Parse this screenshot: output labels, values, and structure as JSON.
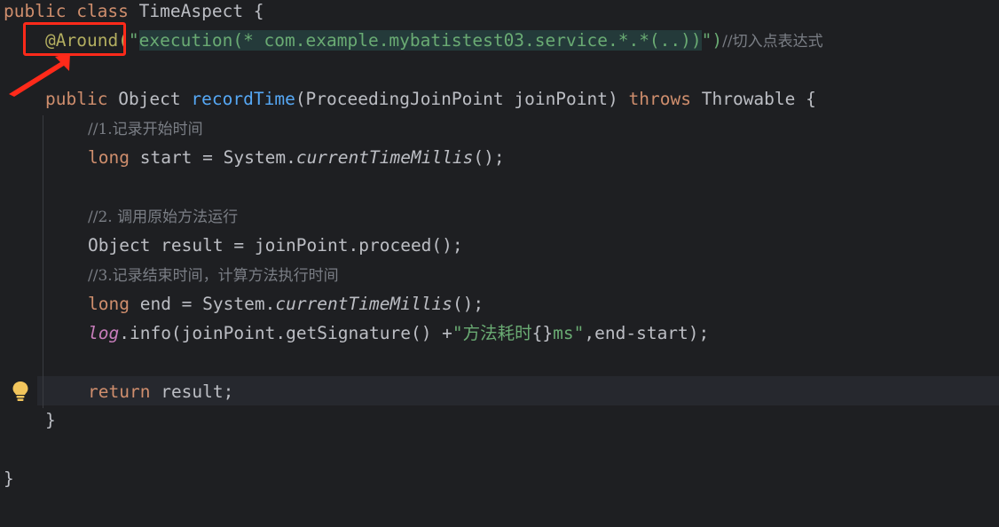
{
  "code": {
    "l1_public": "public",
    "l1_class": "class",
    "l1_name": "TimeAspect {",
    "l2_anno": "@Around(",
    "l2_quote_open": "\"",
    "l2_expr": "execution(* com.example.mybatistest03.service.*.*(..))",
    "l2_quote_close": "\")",
    "l2_comment": "//切入点表达式",
    "l3_public": "public",
    "l3_type": "Object",
    "l3_method": "recordTime",
    "l3_params": "(ProceedingJoinPoint joinPoint)",
    "l3_throws": "throws",
    "l3_rest": "Throwable {",
    "l4_comment": "//1.记录开始时间",
    "l5_long": "long",
    "l5_var": "start = System.",
    "l5_call": "currentTimeMillis",
    "l5_end": "();",
    "l6_comment": "//2. 调用原始方法运行",
    "l7_code": "Object result = joinPoint.proceed();",
    "l8_comment": "//3.记录结束时间，计算方法执行时间",
    "l9_long": "long",
    "l9_var": "end = System.",
    "l9_call": "currentTimeMillis",
    "l9_end": "();",
    "l10_log": "log",
    "l10_mid": ".info(joinPoint.getSignature() +",
    "l10_str1": "\"方法耗时",
    "l10_braces": "{}",
    "l10_str2": "ms\"",
    "l10_end": ",end-start);",
    "l11_return": "return",
    "l11_rest": "result;",
    "l12_close": "}",
    "l13_close": "}"
  },
  "icons": {
    "bulb": "lightbulb-icon",
    "arrow": "red-arrow-annotation"
  },
  "colors": {
    "background": "#1e1f22",
    "keyword": "#cf8e6d",
    "method": "#56a8f5",
    "annotation": "#b3ae60",
    "string": "#6aab73",
    "comment": "#7a7e85",
    "field": "#c77dbb",
    "highlight_box": "#ff2a1a"
  }
}
